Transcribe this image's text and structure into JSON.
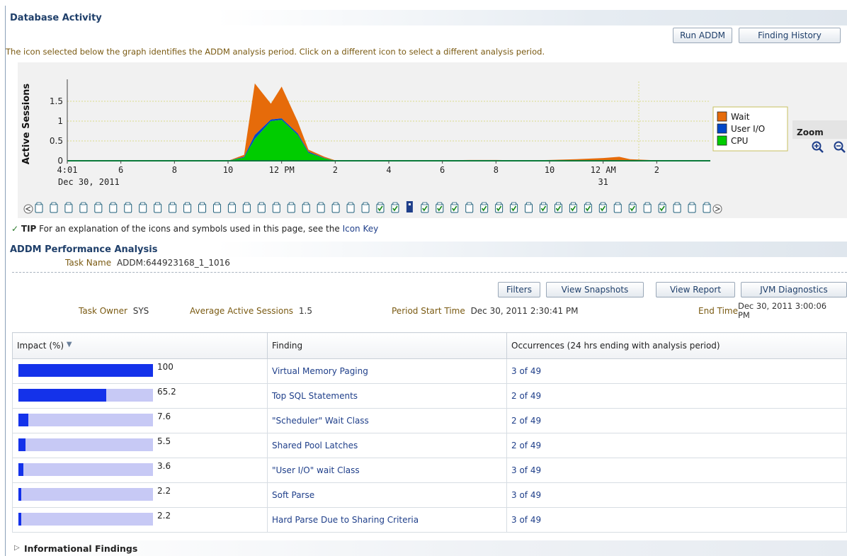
{
  "database_activity": {
    "title": "Database Activity",
    "run_addm_button": "Run ADDM",
    "finding_history_button": "Finding History",
    "instruction": "The icon selected below the graph identifies the ADDM analysis period. Click on a different icon to select a different analysis period.",
    "zoom_label": "Zoom"
  },
  "chart_data": {
    "type": "area",
    "ylabel": "Active Sessions",
    "yticks": [
      "0",
      "0.5",
      "1",
      "1.5"
    ],
    "ylim": [
      0,
      2
    ],
    "xticks": [
      "4:01",
      "6",
      "8",
      "10",
      "12 PM",
      "2",
      "4",
      "6",
      "8",
      "10",
      "12 AM",
      "2"
    ],
    "date_labels": [
      "Dec 30, 2011",
      "31"
    ],
    "x_hours": [
      0,
      1,
      2,
      3,
      4,
      5,
      6,
      7,
      8,
      9,
      10,
      11,
      12,
      13,
      14,
      15,
      16,
      17,
      18,
      19,
      20,
      21,
      22,
      23,
      24
    ],
    "series": [
      {
        "name": "CPU",
        "color": "#00cc00",
        "values": [
          0,
          0,
          0,
          0,
          0,
          0,
          0,
          0,
          0,
          0,
          0,
          0,
          0,
          0,
          0,
          0,
          0,
          0,
          0,
          0,
          0,
          0,
          0,
          0,
          0
        ]
      },
      {
        "name": "User I/O",
        "color": "#0047c8",
        "values": [
          0,
          0,
          0,
          0,
          0,
          0,
          0,
          0,
          0,
          0,
          0,
          0,
          0,
          0,
          0,
          0,
          0,
          0,
          0,
          0,
          0,
          0,
          0,
          0,
          0
        ]
      },
      {
        "name": "Wait",
        "color": "#e66b0a",
        "values": [
          0,
          0,
          0,
          0,
          0,
          0,
          0,
          0,
          0,
          0,
          0,
          0,
          0,
          0,
          0,
          0,
          0,
          0,
          0,
          0,
          0,
          0,
          0,
          0,
          0
        ]
      }
    ],
    "area_points": {
      "hours": [
        0,
        1,
        2,
        3,
        4,
        5,
        6,
        6.6,
        7.0,
        7.6,
        8.0,
        8.6,
        9.0,
        9.6,
        10,
        11,
        12,
        13,
        14,
        15,
        16,
        17,
        18,
        19,
        20,
        20.6,
        21,
        22,
        23
      ],
      "cpu": [
        0,
        0,
        0,
        0,
        0,
        0,
        0,
        0.08,
        0.55,
        1.0,
        1.03,
        0.65,
        0.2,
        0.06,
        0,
        0,
        0,
        0,
        0,
        0,
        0,
        0,
        0,
        0,
        0,
        0,
        0,
        0,
        0
      ],
      "io": [
        0,
        0,
        0,
        0,
        0,
        0,
        0,
        0.02,
        0.1,
        0.04,
        0.04,
        0.04,
        0.03,
        0.01,
        0,
        0,
        0,
        0,
        0,
        0,
        0,
        0,
        0,
        0,
        0,
        0,
        0,
        0,
        0
      ],
      "wait": [
        0,
        0,
        0.01,
        0,
        0,
        0,
        0,
        0.05,
        1.3,
        0.4,
        0.8,
        0.3,
        0.05,
        0.03,
        0.01,
        0,
        0,
        0,
        0.01,
        0.02,
        0.02,
        0.01,
        0.02,
        0.04,
        0.07,
        0.1,
        0.04,
        0.01,
        0
      ]
    },
    "legend": [
      "Wait",
      "User I/O",
      "CPU"
    ],
    "legend_position": "right"
  },
  "snapshot_icons": {
    "count": 46,
    "checked": [
      23,
      24,
      26,
      27,
      28,
      30,
      31,
      32,
      34,
      35,
      36,
      37,
      38,
      40,
      42
    ],
    "selected": 25
  },
  "tip": {
    "label": "TIP",
    "text": "For an explanation of the icons and symbols used in this page, see the",
    "link": "Icon Key"
  },
  "addm": {
    "title": "ADDM Performance Analysis",
    "task_name_label": "Task Name",
    "task_name": "ADDM:644923168_1_1016",
    "filters_button": "Filters",
    "view_snapshots_button": "View Snapshots",
    "view_report_button": "View Report",
    "jvm_button": "JVM Diagnostics",
    "task_owner_label": "Task Owner",
    "task_owner": "SYS",
    "avg_sessions_label": "Average Active Sessions",
    "avg_sessions": "1.5",
    "period_start_label": "Period Start Time",
    "period_start": "Dec 30, 2011 2:30:41 PM",
    "end_time_label": "End Time",
    "end_time_line1": "Dec 30, 2011 3:00:06",
    "end_time_line2": "PM"
  },
  "findings_table": {
    "headers": {
      "impact": "Impact (%)",
      "finding": "Finding",
      "occurrences": "Occurrences (24 hrs ending with analysis period)"
    },
    "rows": [
      {
        "impact": 100,
        "impact_label": "100",
        "finding": "Virtual Memory Paging",
        "occurrences": "3 of 49"
      },
      {
        "impact": 65.2,
        "impact_label": "65.2",
        "finding": "Top SQL Statements",
        "occurrences": "2 of 49"
      },
      {
        "impact": 7.6,
        "impact_label": "7.6",
        "finding": "\"Scheduler\" Wait Class",
        "occurrences": "2 of 49"
      },
      {
        "impact": 5.5,
        "impact_label": "5.5",
        "finding": "Shared Pool Latches",
        "occurrences": "2 of 49"
      },
      {
        "impact": 3.6,
        "impact_label": "3.6",
        "finding": "\"User I/O\" wait Class",
        "occurrences": "3 of 49"
      },
      {
        "impact": 2.2,
        "impact_label": "2.2",
        "finding": "Soft Parse",
        "occurrences": "3 of 49"
      },
      {
        "impact": 2.2,
        "impact_label": "2.2",
        "finding": "Hard Parse Due to Sharing Criteria",
        "occurrences": "3 of 49"
      }
    ]
  },
  "informational_findings": {
    "label": "Informational Findings"
  }
}
